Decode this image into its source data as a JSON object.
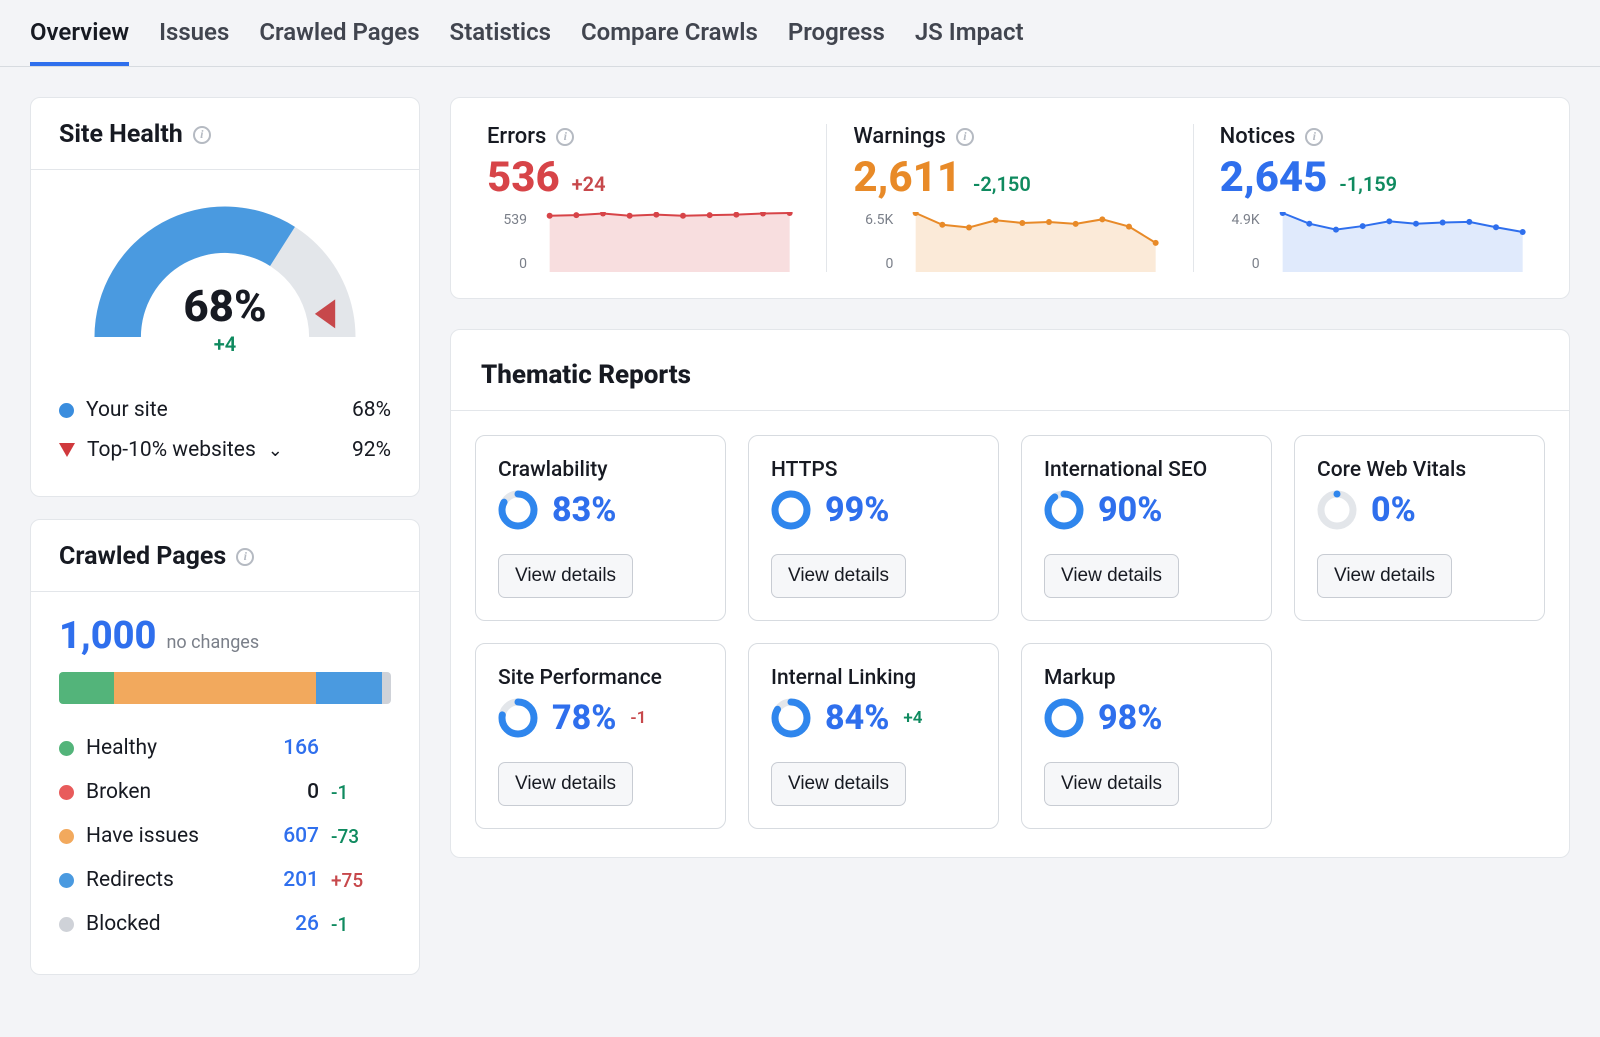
{
  "tabs": [
    "Overview",
    "Issues",
    "Crawled Pages",
    "Statistics",
    "Compare Crawls",
    "Progress",
    "JS Impact"
  ],
  "active_tab": 0,
  "site_health": {
    "title": "Site Health",
    "score": "68%",
    "score_num": 68,
    "delta": "+4",
    "legend": [
      {
        "label": "Your site",
        "value": "68%"
      },
      {
        "label": "Top-10% websites",
        "value": "92%"
      }
    ]
  },
  "crawled_pages": {
    "title": "Crawled Pages",
    "total": "1,000",
    "total_note": "no changes",
    "segments": [
      {
        "name": "Healthy",
        "count": "166",
        "delta": "",
        "color": "green",
        "pct": 16.6
      },
      {
        "name": "Broken",
        "count": "0",
        "delta": "-1",
        "color": "red",
        "pct": 0
      },
      {
        "name": "Have issues",
        "count": "607",
        "delta": "-73",
        "color": "orange",
        "pct": 60.7
      },
      {
        "name": "Redirects",
        "count": "201",
        "delta": "+75",
        "color": "lblue",
        "pct": 20.1
      },
      {
        "name": "Blocked",
        "count": "26",
        "delta": "-1",
        "color": "grey",
        "pct": 2.6
      }
    ]
  },
  "metrics": [
    {
      "title": "Errors",
      "value": "536",
      "delta": "+24",
      "delta_sign": "neg",
      "color": "c-error",
      "ymax": "539",
      "ymin": "0",
      "spark_fill": "rgba(214,73,78,0.18)",
      "spark_stroke": "#d74448",
      "points": [
        500,
        505,
        520,
        500,
        510,
        500,
        505,
        510,
        520,
        525
      ]
    },
    {
      "title": "Warnings",
      "value": "2,611",
      "delta": "-2,150",
      "delta_sign": "pos",
      "color": "c-warn",
      "ymax": "6.5K",
      "ymin": "0",
      "spark_fill": "rgba(232,138,40,0.18)",
      "spark_stroke": "#e88a28",
      "points": [
        6300,
        5000,
        4700,
        5500,
        5200,
        5300,
        5100,
        5600,
        4800,
        3000
      ]
    },
    {
      "title": "Notices",
      "value": "2,645",
      "delta": "-1,159",
      "delta_sign": "pos",
      "color": "c-notice",
      "ymax": "4.9K",
      "ymin": "0",
      "spark_fill": "rgba(47,111,237,0.15)",
      "spark_stroke": "#2f6fed",
      "points": [
        4800,
        3900,
        3400,
        3700,
        4100,
        3900,
        4000,
        4050,
        3600,
        3200
      ]
    }
  ],
  "thematic": {
    "title": "Thematic Reports",
    "view_label": "View details",
    "reports": [
      {
        "name": "Crawlability",
        "pct": 83,
        "label": "83%",
        "delta": ""
      },
      {
        "name": "HTTPS",
        "pct": 99,
        "label": "99%",
        "delta": ""
      },
      {
        "name": "International SEO",
        "pct": 90,
        "label": "90%",
        "delta": ""
      },
      {
        "name": "Core Web Vitals",
        "pct": 0,
        "label": "0%",
        "delta": ""
      },
      {
        "name": "Site Performance",
        "pct": 78,
        "label": "78%",
        "delta": "-1",
        "delta_sign": "neg"
      },
      {
        "name": "Internal Linking",
        "pct": 84,
        "label": "84%",
        "delta": "+4",
        "delta_sign": "pos"
      },
      {
        "name": "Markup",
        "pct": 98,
        "label": "98%",
        "delta": ""
      }
    ]
  },
  "chart_data": {
    "sparklines": [
      {
        "type": "area",
        "title": "Errors",
        "ylim": [
          0,
          539
        ],
        "values": [
          500,
          505,
          520,
          500,
          510,
          500,
          505,
          510,
          520,
          525
        ]
      },
      {
        "type": "area",
        "title": "Warnings",
        "ylim": [
          0,
          6500
        ],
        "values": [
          6300,
          5000,
          4700,
          5500,
          5200,
          5300,
          5100,
          5600,
          4800,
          3000
        ]
      },
      {
        "type": "area",
        "title": "Notices",
        "ylim": [
          0,
          4900
        ],
        "values": [
          4800,
          3900,
          3400,
          3700,
          4100,
          3900,
          4000,
          4050,
          3600,
          3200
        ]
      }
    ],
    "site_health_gauge": {
      "type": "gauge",
      "value": 68,
      "max": 100,
      "threshold_marker": 92
    },
    "crawled_pages_stack": {
      "type": "stacked_bar",
      "segments": {
        "Healthy": 166,
        "Broken": 0,
        "Have issues": 607,
        "Redirects": 201,
        "Blocked": 26
      }
    },
    "thematic_donuts": [
      {
        "name": "Crawlability",
        "pct": 83
      },
      {
        "name": "HTTPS",
        "pct": 99
      },
      {
        "name": "International SEO",
        "pct": 90
      },
      {
        "name": "Core Web Vitals",
        "pct": 0
      },
      {
        "name": "Site Performance",
        "pct": 78
      },
      {
        "name": "Internal Linking",
        "pct": 84
      },
      {
        "name": "Markup",
        "pct": 98
      }
    ]
  }
}
